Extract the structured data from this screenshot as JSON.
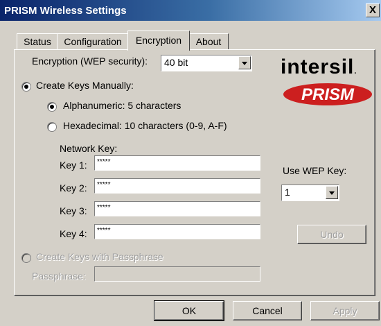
{
  "window": {
    "title": "PRISM Wireless Settings",
    "close_label": "X"
  },
  "tabs": [
    {
      "label": "Status"
    },
    {
      "label": "Configuration"
    },
    {
      "label": "Encryption"
    },
    {
      "label": "About"
    }
  ],
  "active_tab": "Encryption",
  "encryption": {
    "label": "Encryption (WEP security):",
    "selected": "40 bit"
  },
  "manual": {
    "label": "Create Keys Manually:",
    "alnum_label": "Alphanumeric: 5 characters",
    "hex_label": "Hexadecimal: 10 characters (0-9, A-F)",
    "network_key_label": "Network Key:",
    "keys": [
      {
        "label": "Key 1:",
        "value": "*****"
      },
      {
        "label": "Key 2:",
        "value": "*****"
      },
      {
        "label": "Key 3:",
        "value": "*****"
      },
      {
        "label": "Key 4:",
        "value": "*****"
      }
    ]
  },
  "use_wep": {
    "label": "Use WEP Key:",
    "selected": "1"
  },
  "undo_label": "Undo",
  "passphrase": {
    "option_label": "Create Keys with Passphrase",
    "field_label": "Passphrase:",
    "value": ""
  },
  "logo": {
    "brand": "intersil",
    "product": "PRISM"
  },
  "buttons": {
    "ok": "OK",
    "cancel": "Cancel",
    "apply": "Apply"
  },
  "colors": {
    "dialog": "#d4d0c8",
    "titlebar": "#0a246a",
    "prism_red": "#cc1f1f"
  }
}
